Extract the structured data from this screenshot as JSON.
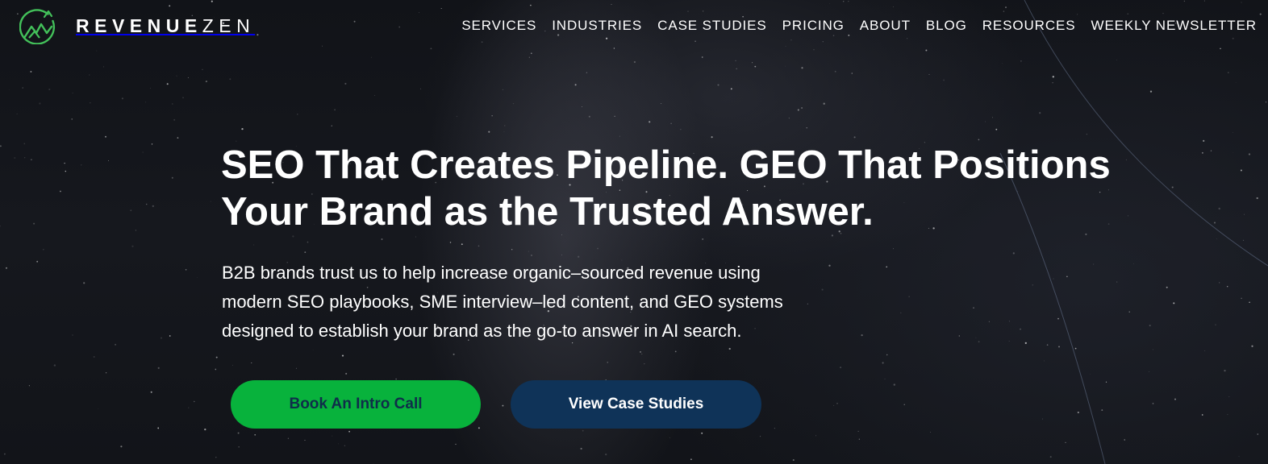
{
  "brand": {
    "name_part1": "REVENUE",
    "name_part2": "ZEN",
    "logo_icon": "mountain-peaks-icon",
    "logo_color": "#43c15a"
  },
  "nav": {
    "items": [
      {
        "label": "SERVICES"
      },
      {
        "label": "INDUSTRIES"
      },
      {
        "label": "CASE STUDIES"
      },
      {
        "label": "PRICING"
      },
      {
        "label": "ABOUT"
      },
      {
        "label": "BLOG"
      },
      {
        "label": "RESOURCES"
      },
      {
        "label": "WEEKLY NEWSLETTER"
      }
    ]
  },
  "hero": {
    "headline_line1": "SEO That Creates Pipeline. GEO That Positions",
    "headline_line2": "Your Brand as the Trusted Answer.",
    "subtext_line1": "B2B brands trust us to help increase organic–sourced revenue using",
    "subtext_line2": "modern SEO playbooks, SME interview–led content, and GEO systems",
    "subtext_line3": "designed to establish your brand as the go-to answer in AI search.",
    "primary_cta": "Book An Intro Call",
    "secondary_cta": "View Case Studies"
  },
  "colors": {
    "background": "#14161b",
    "primary_button": "#08b23c",
    "primary_button_text": "#0f2d4a",
    "secondary_button": "#0f3358",
    "text": "#ffffff"
  }
}
